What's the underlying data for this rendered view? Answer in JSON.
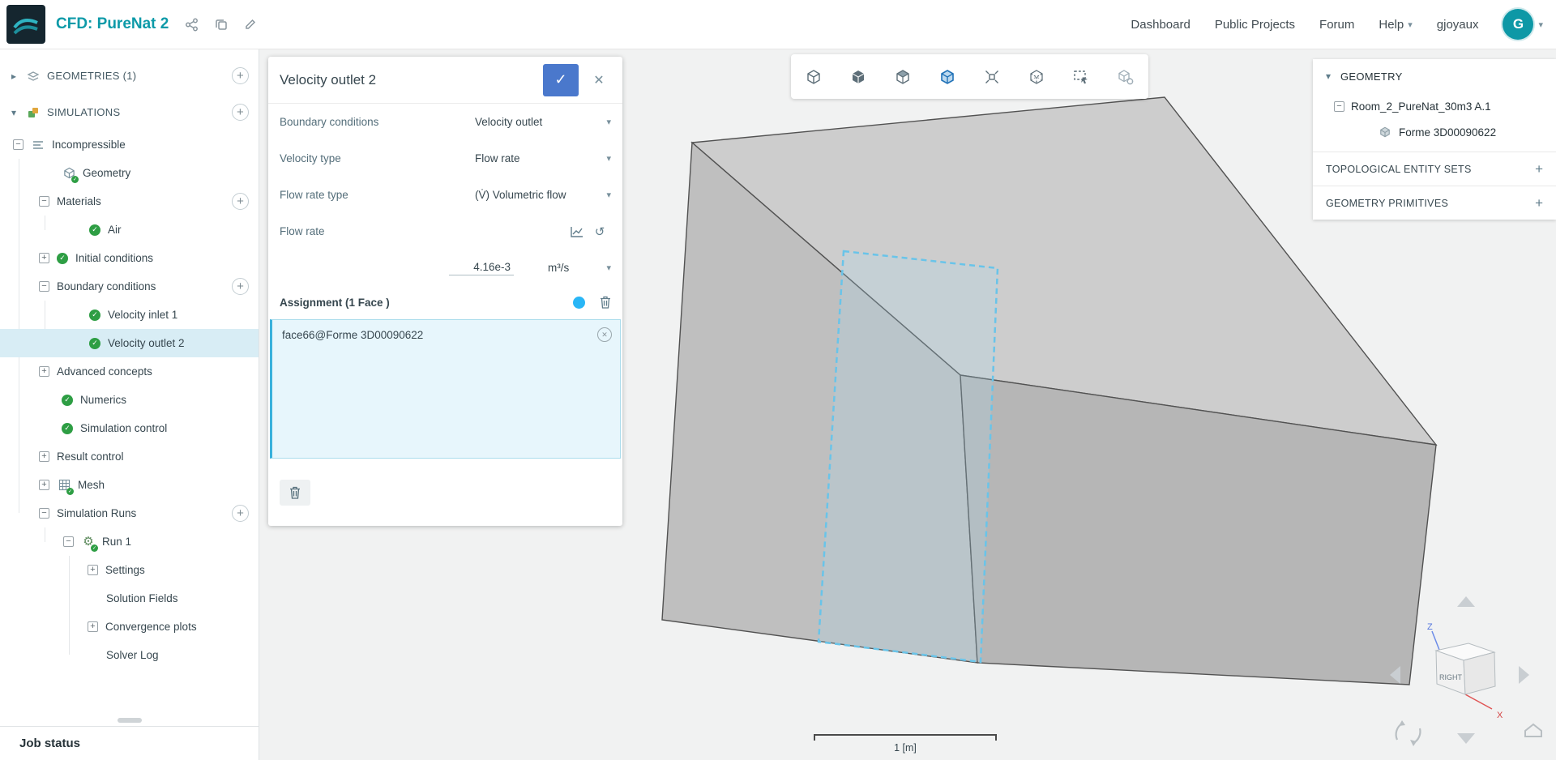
{
  "topbar": {
    "title": "CFD: PureNat 2",
    "nav": {
      "dashboard": "Dashboard",
      "public_projects": "Public Projects",
      "forum": "Forum",
      "help": "Help",
      "username": "gjoyaux",
      "avatar_initial": "G"
    }
  },
  "sidebar": {
    "geometries_header": "GEOMETRIES (1)",
    "simulations_header": "SIMULATIONS",
    "job_status": "Job status",
    "tree": {
      "incompressible": "Incompressible",
      "geometry": "Geometry",
      "materials": "Materials",
      "air": "Air",
      "initial_conditions": "Initial conditions",
      "boundary_conditions": "Boundary conditions",
      "velocity_inlet_1": "Velocity inlet 1",
      "velocity_outlet_2": "Velocity outlet 2",
      "advanced_concepts": "Advanced concepts",
      "numerics": "Numerics",
      "simulation_control": "Simulation control",
      "result_control": "Result control",
      "mesh": "Mesh",
      "simulation_runs": "Simulation Runs",
      "run_1": "Run 1",
      "settings": "Settings",
      "solution_fields": "Solution Fields",
      "convergence_plots": "Convergence plots",
      "solver_log": "Solver Log"
    }
  },
  "panel": {
    "title": "Velocity outlet 2",
    "rows": [
      {
        "label": "Boundary conditions",
        "value": "Velocity outlet"
      },
      {
        "label": "Velocity type",
        "value": "Flow rate"
      },
      {
        "label": "Flow rate type",
        "value": "(V̇) Volumetric flow"
      }
    ],
    "flow_rate": {
      "label": "Flow rate",
      "value": "4.16e-3",
      "unit": "m³/s"
    },
    "assignment": {
      "header": "Assignment (1 Face )",
      "face": "face66@Forme 3D00090622"
    }
  },
  "right_panel": {
    "geometry_header": "GEOMETRY",
    "root_item": "Room_2_PureNat_30m3 A.1",
    "child_item": "Forme 3D00090622",
    "section_topological": "TOPOLOGICAL ENTITY SETS",
    "section_primitives": "GEOMETRY PRIMITIVES"
  },
  "viewport": {
    "scale_label": "1 [m]",
    "gizmo": {
      "front_face_label": "RIGHT",
      "axis_z": "Z",
      "axis_x": "X"
    },
    "toolbar_icons": [
      "view-cube",
      "solid-view",
      "hidden-line-view",
      "surfaces-edges-view",
      "explode-view",
      "transparent-view",
      "box-select",
      "render-settings"
    ]
  },
  "colors": {
    "brand_teal": "#0d9aa8",
    "accent_blue": "#4a78cc",
    "selection_bg": "#d8edf5",
    "success_green": "#2e9e44",
    "assignment_bg": "#e7f6fc",
    "highlight_cyan": "#69c4e9",
    "viewport_bg": "#f1f2f2"
  },
  "icons": {
    "check": "✓",
    "close": "✕",
    "plus": "+",
    "minus": "−",
    "chevron_down": "▾",
    "chevron_right": "▸",
    "undo": "↺",
    "gear": "⚙"
  }
}
